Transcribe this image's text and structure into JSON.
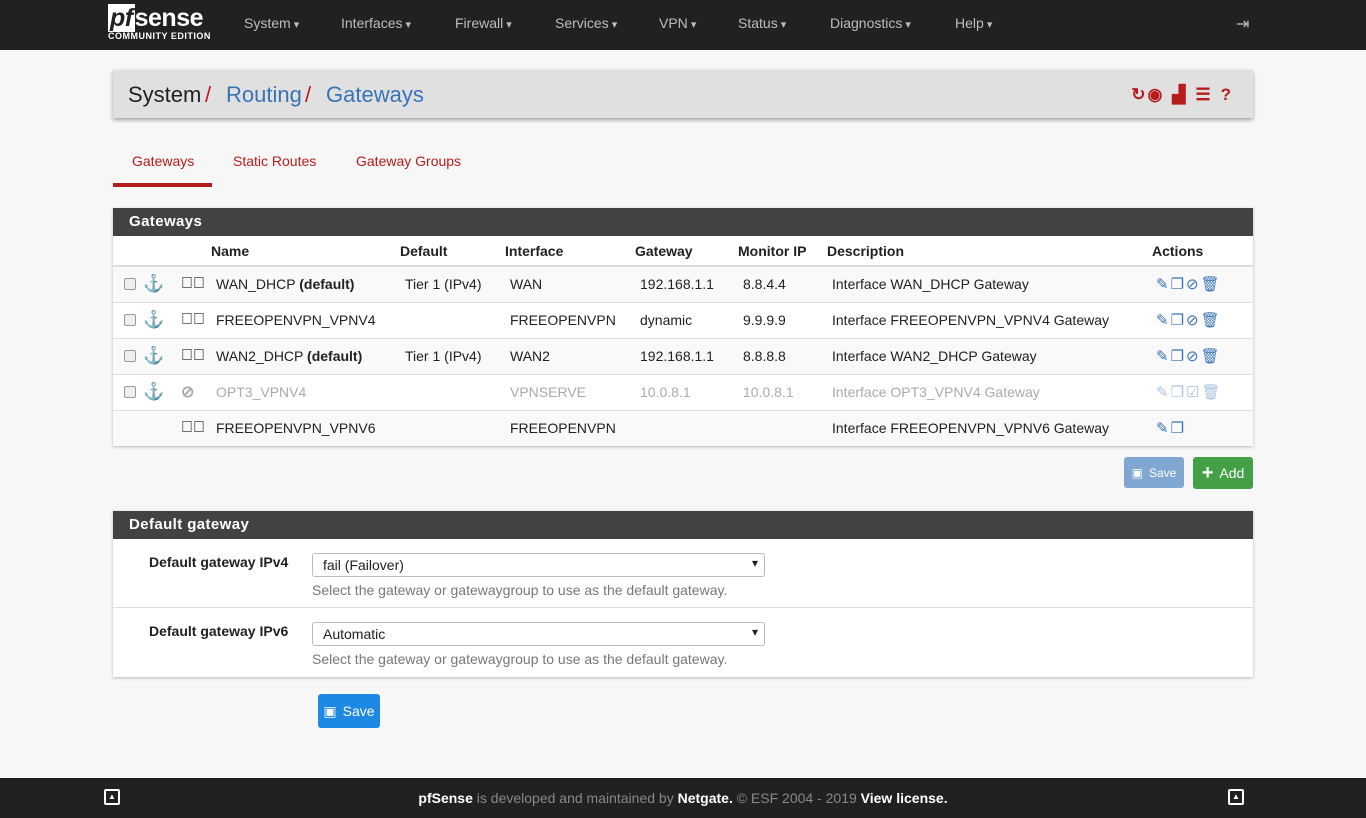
{
  "nav": {
    "logo_main": "pfsense",
    "logo_sub": "COMMUNITY EDITION",
    "menus": [
      "System",
      "Interfaces",
      "Firewall",
      "Services",
      "VPN",
      "Status",
      "Diagnostics",
      "Help"
    ]
  },
  "breadcrumb": [
    "System",
    "Routing",
    "Gateways"
  ],
  "tabs": [
    "Gateways",
    "Static Routes",
    "Gateway Groups"
  ],
  "gateways": {
    "title": "Gateways",
    "columns": [
      "Name",
      "Default",
      "Interface",
      "Gateway",
      "Monitor IP",
      "Description",
      "Actions"
    ],
    "rows": [
      {
        "name": "WAN_DHCP",
        "tag": "(default)",
        "default": "Tier 1 (IPv4)",
        "interface": "WAN",
        "gateway": "192.168.1.1",
        "monitor": "8.8.4.4",
        "description": "Interface WAN_DHCP Gateway",
        "status": "online"
      },
      {
        "name": "FREEOPENVPN_VPNV4",
        "tag": "",
        "default": "",
        "interface": "FREEOPENVPN",
        "gateway": "dynamic",
        "monitor": "9.9.9.9",
        "description": "Interface FREEOPENVPN_VPNV4 Gateway",
        "status": "online"
      },
      {
        "name": "WAN2_DHCP",
        "tag": "(default)",
        "default": "Tier 1 (IPv4)",
        "interface": "WAN2",
        "gateway": "192.168.1.1",
        "monitor": "8.8.8.8",
        "description": "Interface WAN2_DHCP Gateway",
        "status": "online"
      },
      {
        "name": "OPT3_VPNV4",
        "tag": "",
        "default": "",
        "interface": "VPNSERVE",
        "gateway": "10.0.8.1",
        "monitor": "10.0.8.1",
        "description": "Interface OPT3_VPNV4 Gateway",
        "status": "disabled"
      },
      {
        "name": "FREEOPENVPN_VPNV6",
        "tag": "",
        "default": "",
        "interface": "FREEOPENVPN",
        "gateway": "",
        "monitor": "",
        "description": "Interface FREEOPENVPN_VPNV6 Gateway",
        "status": "online"
      }
    ],
    "save_label": "Save",
    "add_label": "Add"
  },
  "default_gateway": {
    "title": "Default gateway",
    "ipv4_label": "Default gateway IPv4",
    "ipv4_value": "fail (Failover)",
    "ipv6_label": "Default gateway IPv6",
    "ipv6_value": "Automatic",
    "help": "Select the gateway or gatewaygroup to use as the default gateway.",
    "save_label": "Save"
  },
  "footer": {
    "brand": "pfSense",
    "text1": " is developed and maintained by ",
    "company": "Netgate.",
    "text2": " © ESF 2004 - 2019 ",
    "license": "View license."
  },
  "colors": {
    "accent": "#b71c1c",
    "link": "#3873b6",
    "success": "#43a047",
    "nav": "#212121"
  }
}
